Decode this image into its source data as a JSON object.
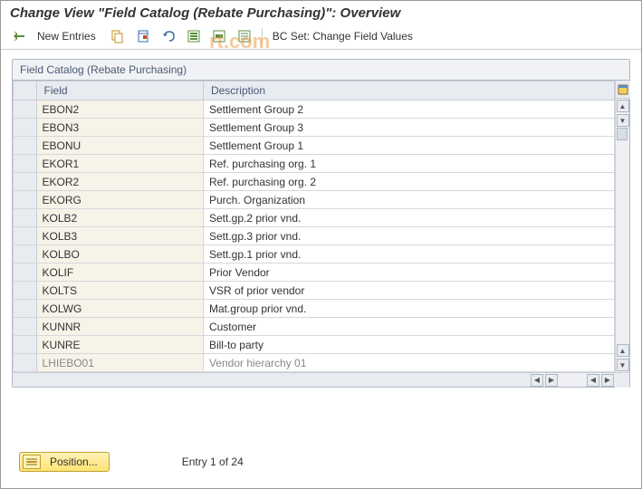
{
  "title": "Change View \"Field Catalog (Rebate Purchasing)\": Overview",
  "toolbar": {
    "new_entries_label": "New Entries",
    "bc_set_label": "BC Set: Change Field Values"
  },
  "panel": {
    "header": "Field Catalog (Rebate Purchasing)",
    "columns": {
      "field": "Field",
      "description": "Description"
    }
  },
  "rows": [
    {
      "field": "EBON2",
      "desc": "Settlement Group 2"
    },
    {
      "field": "EBON3",
      "desc": "Settlement Group 3"
    },
    {
      "field": "EBONU",
      "desc": "Settlement Group 1"
    },
    {
      "field": "EKOR1",
      "desc": "Ref. purchasing org. 1"
    },
    {
      "field": "EKOR2",
      "desc": "Ref. purchasing org. 2"
    },
    {
      "field": "EKORG",
      "desc": "Purch. Organization"
    },
    {
      "field": "KOLB2",
      "desc": "Sett.gp.2 prior vnd."
    },
    {
      "field": "KOLB3",
      "desc": "Sett.gp.3 prior vnd."
    },
    {
      "field": "KOLBO",
      "desc": "Sett.gp.1 prior vnd."
    },
    {
      "field": "KOLIF",
      "desc": "Prior Vendor"
    },
    {
      "field": "KOLTS",
      "desc": "VSR of prior vendor"
    },
    {
      "field": "KOLWG",
      "desc": "Mat.group prior vnd."
    },
    {
      "field": "KUNNR",
      "desc": "Customer"
    },
    {
      "field": "KUNRE",
      "desc": "Bill-to party"
    },
    {
      "field": "LHIEBO01",
      "desc": "Vendor hierarchy 01"
    }
  ],
  "footer": {
    "position_label": "Position...",
    "entry_status": "Entry 1 of 24"
  },
  "watermark": "rt.com"
}
